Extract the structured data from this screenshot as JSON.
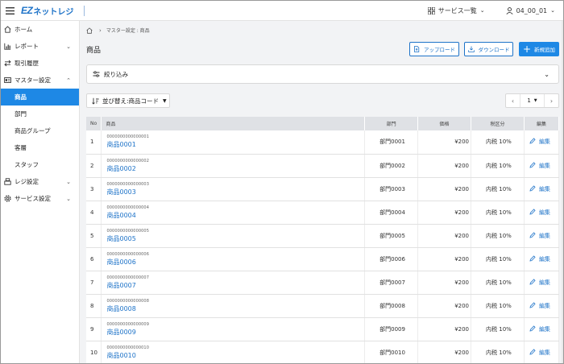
{
  "header": {
    "logo_ez": "EZ",
    "logo_rest": "ネットレジ",
    "services_label": "サービス一覧",
    "user_label": "04_00_01"
  },
  "sidebar": {
    "items": [
      {
        "label": "ホーム",
        "icon": "home-icon"
      },
      {
        "label": "レポート",
        "icon": "chart-icon",
        "expandable": true
      },
      {
        "label": "取引履歴",
        "icon": "swap-icon"
      },
      {
        "label": "マスター設定",
        "icon": "master-icon",
        "expanded": true
      }
    ],
    "master_sub": [
      "商品",
      "部門",
      "商品グループ",
      "客層",
      "スタッフ"
    ],
    "active_sub": "商品",
    "items_after": [
      {
        "label": "レジ設定",
        "icon": "register-icon"
      },
      {
        "label": "サービス設定",
        "icon": "gear-icon"
      }
    ]
  },
  "breadcrumb": {
    "current": "マスター設定 : 商品"
  },
  "page": {
    "title": "商品",
    "upload_label": "アップロード",
    "download_label": "ダウンロード",
    "new_label": "新規追加",
    "filter_label": "絞り込み",
    "sort_label": "並び替え:商品コード",
    "page_number": "1"
  },
  "table": {
    "headers": [
      "No",
      "商品",
      "部門",
      "価格",
      "税区分",
      "編集"
    ],
    "edit_label": "編集",
    "rows": [
      {
        "no": "1",
        "code": "0000000000000001",
        "name": "商品0001",
        "dept": "部門0001",
        "price": "¥200",
        "tax": "内税 10%"
      },
      {
        "no": "2",
        "code": "0000000000000002",
        "name": "商品0002",
        "dept": "部門0002",
        "price": "¥200",
        "tax": "内税 10%"
      },
      {
        "no": "3",
        "code": "0000000000000003",
        "name": "商品0003",
        "dept": "部門0003",
        "price": "¥200",
        "tax": "内税 10%"
      },
      {
        "no": "4",
        "code": "0000000000000004",
        "name": "商品0004",
        "dept": "部門0004",
        "price": "¥200",
        "tax": "内税 10%"
      },
      {
        "no": "5",
        "code": "0000000000000005",
        "name": "商品0005",
        "dept": "部門0005",
        "price": "¥200",
        "tax": "内税 10%"
      },
      {
        "no": "6",
        "code": "0000000000000006",
        "name": "商品0006",
        "dept": "部門0006",
        "price": "¥200",
        "tax": "内税 10%"
      },
      {
        "no": "7",
        "code": "0000000000000007",
        "name": "商品0007",
        "dept": "部門0007",
        "price": "¥200",
        "tax": "内税 10%"
      },
      {
        "no": "8",
        "code": "0000000000000008",
        "name": "商品0008",
        "dept": "部門0008",
        "price": "¥200",
        "tax": "内税 10%"
      },
      {
        "no": "9",
        "code": "0000000000000009",
        "name": "商品0009",
        "dept": "部門0009",
        "price": "¥200",
        "tax": "内税 10%"
      },
      {
        "no": "10",
        "code": "0000000000000010",
        "name": "商品0010",
        "dept": "部門0010",
        "price": "¥200",
        "tax": "内税 10%"
      }
    ]
  },
  "colors": {
    "brand": "#1e73c8",
    "active": "#1e88e5",
    "header_bg": "#dfe1e5"
  }
}
